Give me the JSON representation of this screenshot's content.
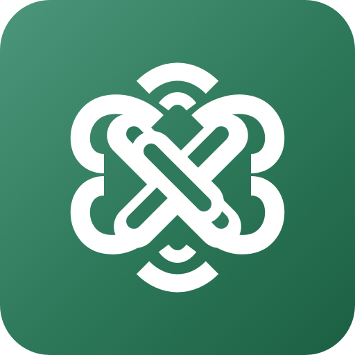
{
  "app_icon": {
    "icon": "celtic-knot-icon",
    "background_gradient": [
      "#4c977c",
      "#2f7a5c",
      "#1b5f42"
    ],
    "logo_color": "#ffffff"
  }
}
